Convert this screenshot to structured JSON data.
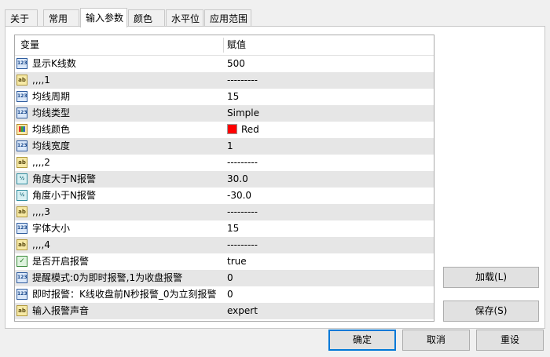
{
  "tabs": [
    {
      "label": "关于",
      "active": false
    },
    {
      "label": "常用",
      "active": false
    },
    {
      "label": "输入参数",
      "active": true
    },
    {
      "label": "颜色",
      "active": false
    },
    {
      "label": "水平位",
      "active": false
    },
    {
      "label": "应用范围",
      "active": false
    }
  ],
  "grid": {
    "columns": {
      "variable": "变量",
      "value": "赋值"
    },
    "rows": [
      {
        "icon": "num",
        "name": "显示K线数",
        "value": "500"
      },
      {
        "icon": "ab",
        "name": ",,,,1",
        "value": "---------"
      },
      {
        "icon": "num",
        "name": "均线周期",
        "value": "15"
      },
      {
        "icon": "num",
        "name": "均线类型",
        "value": "Simple"
      },
      {
        "icon": "color",
        "name": "均线颜色",
        "value": "Red",
        "swatch": "#ff0000"
      },
      {
        "icon": "num",
        "name": "均线宽度",
        "value": "1"
      },
      {
        "icon": "ab",
        "name": ",,,,2",
        "value": "---------"
      },
      {
        "icon": "frac",
        "name": "角度大于N报警",
        "value": "30.0"
      },
      {
        "icon": "frac",
        "name": "角度小于N报警",
        "value": "-30.0"
      },
      {
        "icon": "ab",
        "name": ",,,,3",
        "value": "---------"
      },
      {
        "icon": "num",
        "name": "字体大小",
        "value": "15"
      },
      {
        "icon": "ab",
        "name": ",,,,4",
        "value": "---------"
      },
      {
        "icon": "bool",
        "name": "是否开启报警",
        "value": "true"
      },
      {
        "icon": "num",
        "name": "提醒模式:0为即时报警,1为收盘报警",
        "value": "0"
      },
      {
        "icon": "num",
        "name": "即时报警：K线收盘前N秒报警_0为立刻报警",
        "value": "0"
      },
      {
        "icon": "ab",
        "name": "输入报警声音",
        "value": "expert"
      }
    ]
  },
  "side_buttons": {
    "load": "加载(L)",
    "save": "保存(S)"
  },
  "footer_buttons": {
    "ok": "确定",
    "cancel": "取消",
    "reset": "重设"
  }
}
